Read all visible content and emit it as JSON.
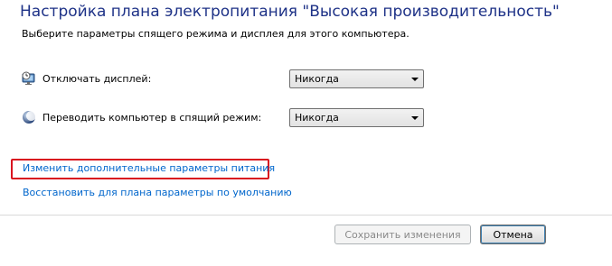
{
  "header": {
    "title": "Настройка плана электропитания \"Высокая производительность\"",
    "subtitle": "Выберите параметры спящего режима и дисплея для этого компьютера."
  },
  "settings": {
    "display_off": {
      "label": "Отключать дисплей:",
      "icon": "display-timer-icon",
      "value": "Никогда"
    },
    "sleep": {
      "label": "Переводить компьютер в спящий режим:",
      "icon": "moon-sleep-icon",
      "value": "Никогда"
    }
  },
  "links": {
    "advanced": "Изменить дополнительные параметры питания",
    "restore": "Восстановить для плана параметры по умолчанию"
  },
  "buttons": {
    "save": "Сохранить изменения",
    "save_disabled": true,
    "cancel": "Отмена"
  },
  "colors": {
    "title": "#1e3287",
    "link": "#0066cc",
    "highlight": "#d9121f"
  }
}
